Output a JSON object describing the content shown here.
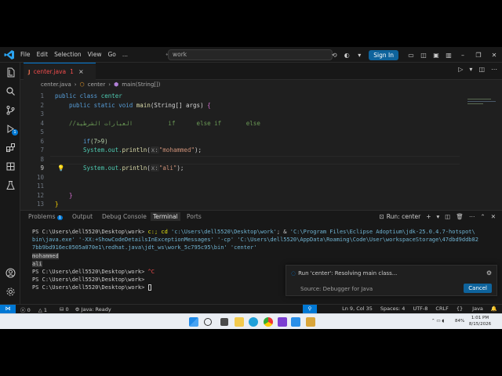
{
  "titlebar": {
    "menu": [
      "File",
      "Edit",
      "Selection",
      "View",
      "Go",
      "..."
    ],
    "command_center": "work",
    "sign_in": "Sign In"
  },
  "tab": {
    "icon_text": "J",
    "name": "center.java",
    "problems": "1",
    "close": "×"
  },
  "breadcrumb": {
    "file": "center.java",
    "class": "center",
    "method": "main(String[])",
    "sep": "›"
  },
  "code": {
    "line_numbers": [
      "1",
      "2",
      "3",
      "4",
      "5",
      "6",
      "7",
      "8",
      "9",
      "10",
      "11",
      "12",
      "13"
    ],
    "active_line": "9",
    "l1_kw": "public class",
    "l1_name": "center",
    "l2_mod": "public static void",
    "l2_fn": "main",
    "l2_params": "(String[] args)",
    "l2_brace": "{",
    "l4_comment": "//العبارات الشرطية          if      else if       else",
    "l6_kw": "if",
    "l6_cond": "(7>9)",
    "l7_prefix": "System.out.",
    "l7_fn": "println",
    "l7_hint": "x:",
    "l7_str": "\"mohammed\"",
    "l7_end": ");",
    "l8_prefix": "System.out.",
    "l8_fn": "println",
    "l8_hint": "x:",
    "l8_str": "\"ali\"",
    "l8_end": ");",
    "l12_brace": "}",
    "l13_brace": "}"
  },
  "panel": {
    "tabs": [
      "Problems",
      "Output",
      "Debug Console",
      "Terminal",
      "Ports"
    ],
    "problems_count": "1",
    "active_tab": "Terminal",
    "run_label": "Run: center"
  },
  "terminal": {
    "prompt1": "PS C:\\Users\\dell5520\\Desktop\\work>",
    "cmd1a": " c:; cd ",
    "cmd1b": "'c:\\Users\\dell5520\\Desktop\\work'",
    "cmd1c": "; & ",
    "cmd1d": "'C:\\Program Files\\Eclipse Adoptium\\jdk-25.0.4.7-hotspot\\",
    "line2": "bin\\java.exe' '-XX:+ShowCodeDetailsInExceptionMessages' '-cp' 'C:\\Users\\dell5520\\AppData\\Roaming\\Code\\User\\workspaceStorage\\47dbd9ddb82",
    "line3": "7bb9bd916ec0505a070e1\\redhat.java\\jdt_ws\\work_5c795c95\\bin' 'center'",
    "out1": "mohammed",
    "out2": "ali",
    "prompt2": "PS C:\\Users\\dell5520\\Desktop\\work>",
    "ctrl_c": "^C",
    "prompt3": "PS C:\\Users\\dell5520\\Desktop\\work>",
    "prompt4": "PS C:\\Users\\dell5520\\Desktop\\work>"
  },
  "notification": {
    "message": "Run 'center': Resolving main class...",
    "source": "Source: Debugger for Java",
    "cancel": "Cancel"
  },
  "statusbar": {
    "errors": "0",
    "warnings": "1",
    "java_status": "Java: Ready",
    "position": "Ln 9, Col 35",
    "spaces": "Spaces: 4",
    "encoding": "UTF-8",
    "eol": "CRLF",
    "language": "Java"
  },
  "taskbar": {
    "battery": "84%",
    "time": "1:01 PM",
    "date": "8/15/2026"
  },
  "colors": {
    "accent": "#0078d4",
    "editor_bg": "#1f1f1f",
    "error": "#f14c4c"
  }
}
